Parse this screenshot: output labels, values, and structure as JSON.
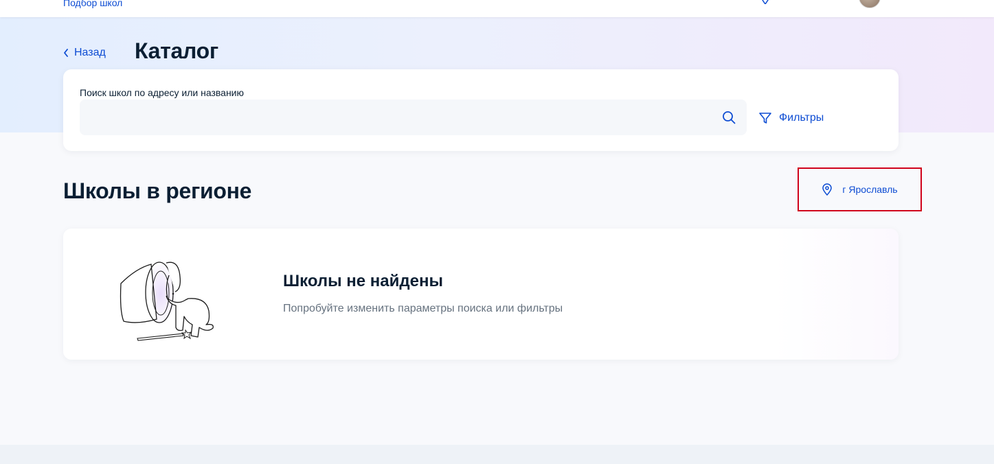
{
  "topbar": {
    "breadcrumb": "Подбор школ",
    "location_icon": "map-pin-icon",
    "avatar_icon": "avatar"
  },
  "header": {
    "back_label": "Назад",
    "title": "Каталог"
  },
  "search": {
    "label": "Поиск школ по адресу или названию",
    "value": "",
    "placeholder": "",
    "icon": "search-icon",
    "filters_label": "Фильтры",
    "filters_icon": "funnel-icon"
  },
  "section": {
    "title": "Школы в регионе",
    "region_label": "г Ярославль",
    "region_icon": "map-pin-icon",
    "highlight_color": "#d0021b"
  },
  "empty_state": {
    "title": "Школы не найдены",
    "text": "Попробуйте изменить параметры поиска или фильтры",
    "illustration": "magic-hat-rabbit-illustration"
  },
  "colors": {
    "accent": "#0d4cd3",
    "text": "#0b1f33",
    "muted": "#66727f",
    "background": "#f8f9fc"
  }
}
